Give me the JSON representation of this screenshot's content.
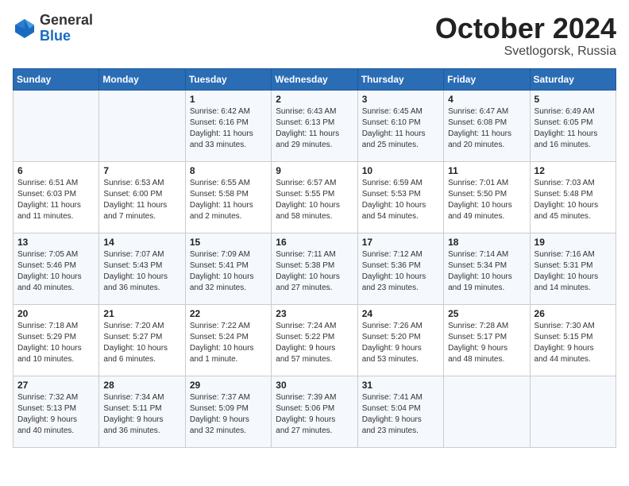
{
  "header": {
    "logo_general": "General",
    "logo_blue": "Blue",
    "title": "October 2024",
    "location": "Svetlogorsk, Russia"
  },
  "days_of_week": [
    "Sunday",
    "Monday",
    "Tuesday",
    "Wednesday",
    "Thursday",
    "Friday",
    "Saturday"
  ],
  "weeks": [
    [
      {
        "day": "",
        "details": ""
      },
      {
        "day": "",
        "details": ""
      },
      {
        "day": "1",
        "details": "Sunrise: 6:42 AM\nSunset: 6:16 PM\nDaylight: 11 hours\nand 33 minutes."
      },
      {
        "day": "2",
        "details": "Sunrise: 6:43 AM\nSunset: 6:13 PM\nDaylight: 11 hours\nand 29 minutes."
      },
      {
        "day": "3",
        "details": "Sunrise: 6:45 AM\nSunset: 6:10 PM\nDaylight: 11 hours\nand 25 minutes."
      },
      {
        "day": "4",
        "details": "Sunrise: 6:47 AM\nSunset: 6:08 PM\nDaylight: 11 hours\nand 20 minutes."
      },
      {
        "day": "5",
        "details": "Sunrise: 6:49 AM\nSunset: 6:05 PM\nDaylight: 11 hours\nand 16 minutes."
      }
    ],
    [
      {
        "day": "6",
        "details": "Sunrise: 6:51 AM\nSunset: 6:03 PM\nDaylight: 11 hours\nand 11 minutes."
      },
      {
        "day": "7",
        "details": "Sunrise: 6:53 AM\nSunset: 6:00 PM\nDaylight: 11 hours\nand 7 minutes."
      },
      {
        "day": "8",
        "details": "Sunrise: 6:55 AM\nSunset: 5:58 PM\nDaylight: 11 hours\nand 2 minutes."
      },
      {
        "day": "9",
        "details": "Sunrise: 6:57 AM\nSunset: 5:55 PM\nDaylight: 10 hours\nand 58 minutes."
      },
      {
        "day": "10",
        "details": "Sunrise: 6:59 AM\nSunset: 5:53 PM\nDaylight: 10 hours\nand 54 minutes."
      },
      {
        "day": "11",
        "details": "Sunrise: 7:01 AM\nSunset: 5:50 PM\nDaylight: 10 hours\nand 49 minutes."
      },
      {
        "day": "12",
        "details": "Sunrise: 7:03 AM\nSunset: 5:48 PM\nDaylight: 10 hours\nand 45 minutes."
      }
    ],
    [
      {
        "day": "13",
        "details": "Sunrise: 7:05 AM\nSunset: 5:46 PM\nDaylight: 10 hours\nand 40 minutes."
      },
      {
        "day": "14",
        "details": "Sunrise: 7:07 AM\nSunset: 5:43 PM\nDaylight: 10 hours\nand 36 minutes."
      },
      {
        "day": "15",
        "details": "Sunrise: 7:09 AM\nSunset: 5:41 PM\nDaylight: 10 hours\nand 32 minutes."
      },
      {
        "day": "16",
        "details": "Sunrise: 7:11 AM\nSunset: 5:38 PM\nDaylight: 10 hours\nand 27 minutes."
      },
      {
        "day": "17",
        "details": "Sunrise: 7:12 AM\nSunset: 5:36 PM\nDaylight: 10 hours\nand 23 minutes."
      },
      {
        "day": "18",
        "details": "Sunrise: 7:14 AM\nSunset: 5:34 PM\nDaylight: 10 hours\nand 19 minutes."
      },
      {
        "day": "19",
        "details": "Sunrise: 7:16 AM\nSunset: 5:31 PM\nDaylight: 10 hours\nand 14 minutes."
      }
    ],
    [
      {
        "day": "20",
        "details": "Sunrise: 7:18 AM\nSunset: 5:29 PM\nDaylight: 10 hours\nand 10 minutes."
      },
      {
        "day": "21",
        "details": "Sunrise: 7:20 AM\nSunset: 5:27 PM\nDaylight: 10 hours\nand 6 minutes."
      },
      {
        "day": "22",
        "details": "Sunrise: 7:22 AM\nSunset: 5:24 PM\nDaylight: 10 hours\nand 1 minute."
      },
      {
        "day": "23",
        "details": "Sunrise: 7:24 AM\nSunset: 5:22 PM\nDaylight: 9 hours\nand 57 minutes."
      },
      {
        "day": "24",
        "details": "Sunrise: 7:26 AM\nSunset: 5:20 PM\nDaylight: 9 hours\nand 53 minutes."
      },
      {
        "day": "25",
        "details": "Sunrise: 7:28 AM\nSunset: 5:17 PM\nDaylight: 9 hours\nand 48 minutes."
      },
      {
        "day": "26",
        "details": "Sunrise: 7:30 AM\nSunset: 5:15 PM\nDaylight: 9 hours\nand 44 minutes."
      }
    ],
    [
      {
        "day": "27",
        "details": "Sunrise: 7:32 AM\nSunset: 5:13 PM\nDaylight: 9 hours\nand 40 minutes."
      },
      {
        "day": "28",
        "details": "Sunrise: 7:34 AM\nSunset: 5:11 PM\nDaylight: 9 hours\nand 36 minutes."
      },
      {
        "day": "29",
        "details": "Sunrise: 7:37 AM\nSunset: 5:09 PM\nDaylight: 9 hours\nand 32 minutes."
      },
      {
        "day": "30",
        "details": "Sunrise: 7:39 AM\nSunset: 5:06 PM\nDaylight: 9 hours\nand 27 minutes."
      },
      {
        "day": "31",
        "details": "Sunrise: 7:41 AM\nSunset: 5:04 PM\nDaylight: 9 hours\nand 23 minutes."
      },
      {
        "day": "",
        "details": ""
      },
      {
        "day": "",
        "details": ""
      }
    ]
  ]
}
